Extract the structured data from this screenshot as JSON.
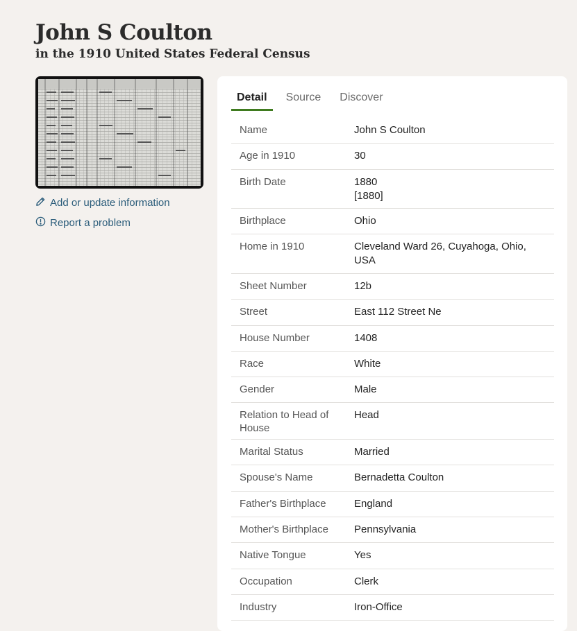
{
  "header": {
    "title": "John S Coulton",
    "subtitle": "in the 1910 United States Federal Census"
  },
  "sidebar": {
    "thumbnail_icon": "census-record-image",
    "actions": [
      {
        "icon": "pencil-icon",
        "label": "Add or update information"
      },
      {
        "icon": "alert-circle-icon",
        "label": "Report a problem"
      }
    ]
  },
  "tabs": [
    {
      "label": "Detail",
      "active": true
    },
    {
      "label": "Source",
      "active": false
    },
    {
      "label": "Discover",
      "active": false
    }
  ],
  "details": [
    {
      "label": "Name",
      "value": [
        "John S Coulton"
      ]
    },
    {
      "label": "Age in 1910",
      "value": [
        "30"
      ]
    },
    {
      "label": "Birth Date",
      "value": [
        "1880",
        "[1880]"
      ]
    },
    {
      "label": "Birthplace",
      "value": [
        "Ohio"
      ]
    },
    {
      "label": "Home in 1910",
      "value": [
        "Cleveland Ward 26, Cuyahoga, Ohio,",
        "USA"
      ]
    },
    {
      "label": "Sheet Number",
      "value": [
        "12b"
      ]
    },
    {
      "label": "Street",
      "value": [
        "East 112 Street Ne"
      ]
    },
    {
      "label": "House Number",
      "value": [
        "1408"
      ]
    },
    {
      "label": "Race",
      "value": [
        "White"
      ]
    },
    {
      "label": "Gender",
      "value": [
        "Male"
      ]
    },
    {
      "label": "Relation to Head of House",
      "value": [
        "Head"
      ]
    },
    {
      "label": "Marital Status",
      "value": [
        "Married"
      ]
    },
    {
      "label": "Spouse's Name",
      "value": [
        "Bernadetta Coulton"
      ]
    },
    {
      "label": "Father's Birthplace",
      "value": [
        "England"
      ]
    },
    {
      "label": "Mother's Birthplace",
      "value": [
        "Pennsylvania"
      ]
    },
    {
      "label": "Native Tongue",
      "value": [
        "Yes"
      ]
    },
    {
      "label": "Occupation",
      "value": [
        "Clerk"
      ]
    },
    {
      "label": "Industry",
      "value": [
        "Iron-Office"
      ]
    }
  ],
  "colors": {
    "background": "#f4f1ee",
    "panel": "#ffffff",
    "link": "#2a5c7a",
    "active_tab_underline": "#3f7b1f"
  }
}
